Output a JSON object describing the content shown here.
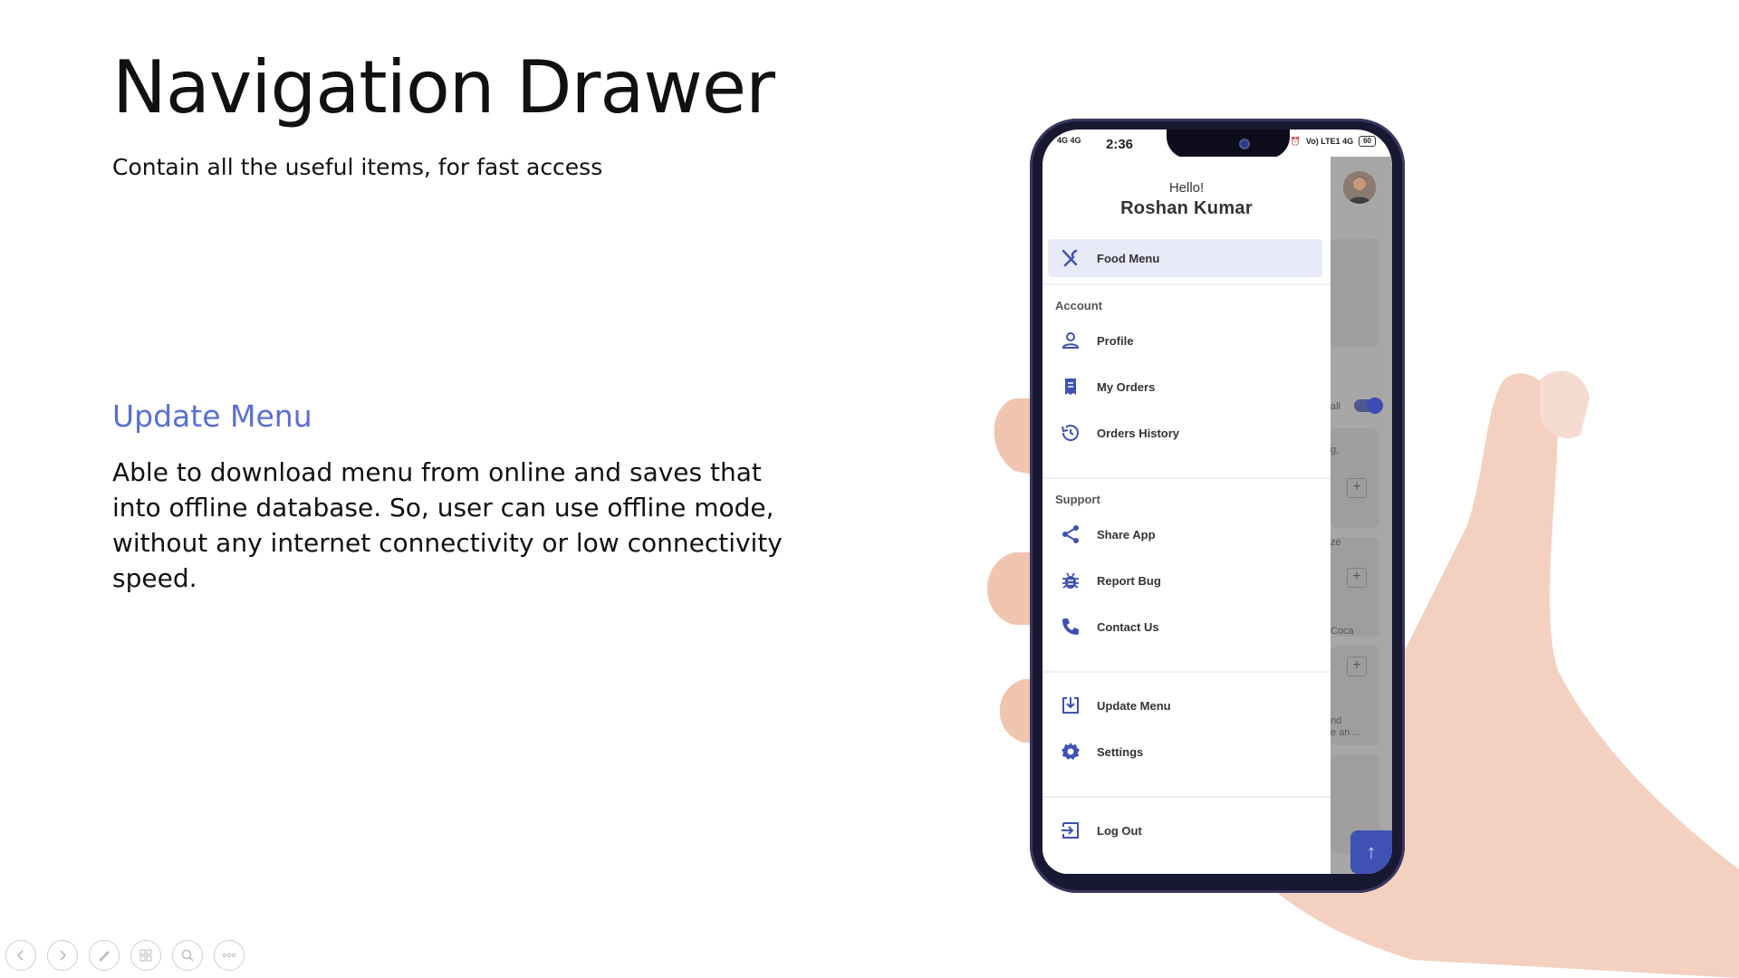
{
  "slide": {
    "title": "Navigation Drawer",
    "subtitle": "Contain all the useful items, for fast access",
    "feature_heading": "Update Menu",
    "feature_body": "Able to download menu from online and saves that into offline database. So, user can use offline mode, without any internet connectivity or low connectivity speed."
  },
  "phone": {
    "status": {
      "time": "2:36",
      "signal_left": "4G 4G",
      "network_right": "Vo) LTE1 4G",
      "battery": "60"
    },
    "drawer": {
      "greeting": "Hello!",
      "user_name": "Roshan Kumar",
      "primary_item": {
        "label": "Food Menu",
        "icon": "restaurant-icon"
      },
      "account_section": "Account",
      "account_items": [
        {
          "label": "Profile",
          "icon": "person-icon"
        },
        {
          "label": "My Orders",
          "icon": "receipt-icon"
        },
        {
          "label": "Orders History",
          "icon": "history-icon"
        }
      ],
      "support_section": "Support",
      "support_items": [
        {
          "label": "Share App",
          "icon": "share-icon"
        },
        {
          "label": "Report Bug",
          "icon": "bug-icon"
        },
        {
          "label": "Contact Us",
          "icon": "phone-icon"
        }
      ],
      "other_items": [
        {
          "label": "Update Menu",
          "icon": "download-icon"
        },
        {
          "label": "Settings",
          "icon": "gear-icon"
        }
      ],
      "logout": {
        "label": "Log Out",
        "icon": "logout-icon"
      }
    },
    "behind": {
      "text_1": "all",
      "text_2": "g,",
      "text_3": "ze",
      "text_4": "Coca",
      "text_5": "nd",
      "text_6": "e an ...",
      "plus": "+"
    }
  },
  "colors": {
    "accent": "#5a6fd4",
    "drawer_icon": "#3f51b5",
    "active_bg": "#e8eaf8"
  }
}
